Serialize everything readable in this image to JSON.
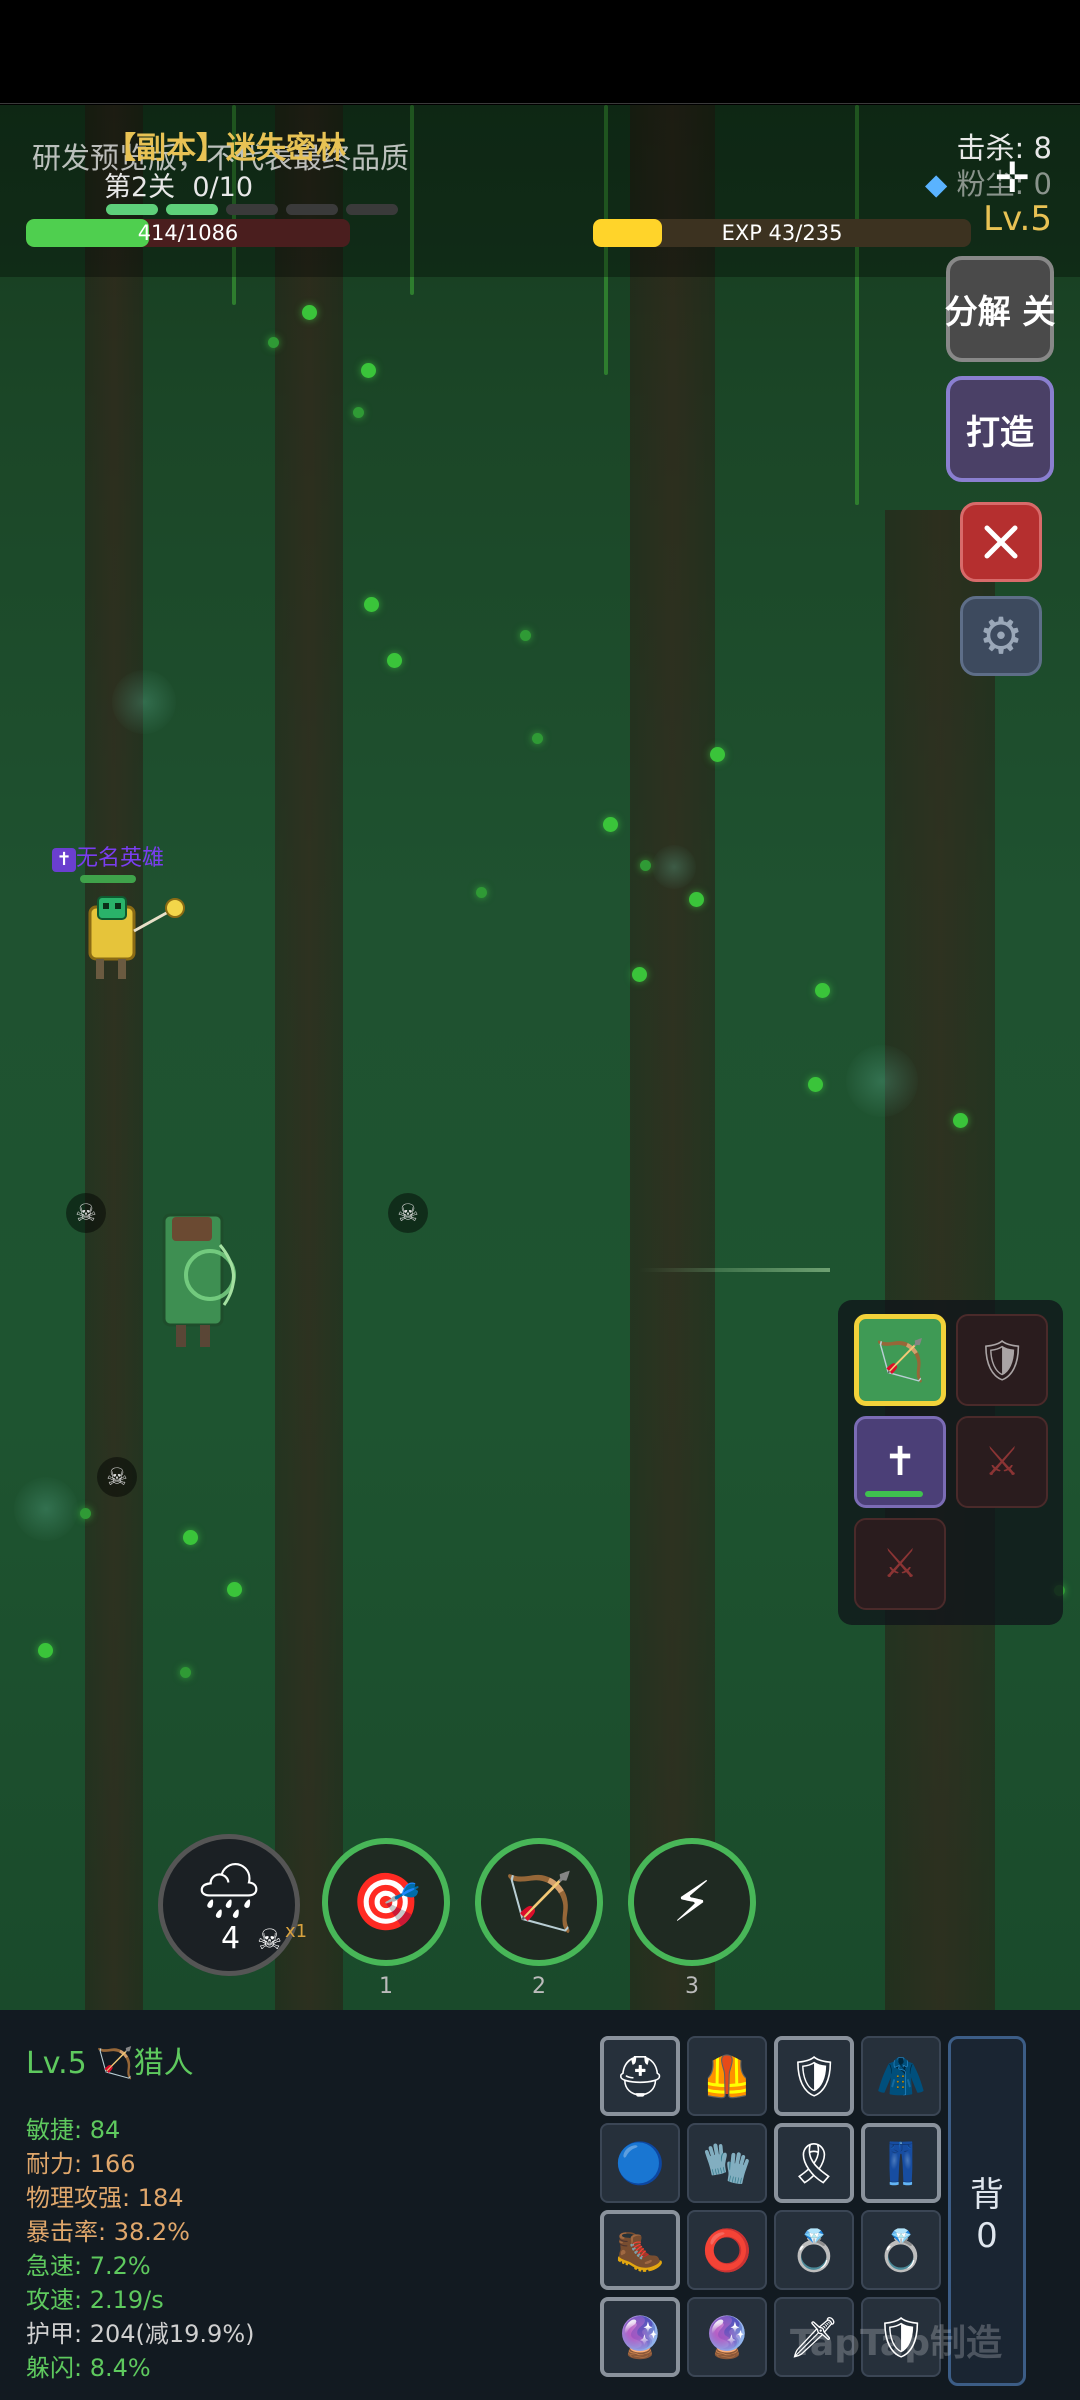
{
  "hud": {
    "dungeon_title": "【副本】迷失密林",
    "dev_notice": "研发预览版，不代表最终品质",
    "stage": "第2关",
    "stage_progress": "0/10",
    "stage_segments_done": 2,
    "stage_segments_total": 5,
    "hp_text": "414/1086",
    "hp_fraction": 0.38,
    "exp_text": "EXP 43/235",
    "exp_fraction": 0.183,
    "kills": "击杀: 8",
    "powder": "粉尘: 0",
    "level": "Lv.5"
  },
  "side_buttons": {
    "decompose": "分解 关",
    "forge": "打造",
    "close_icon": "close-icon",
    "settings_icon": "gear-icon"
  },
  "hero": {
    "name_tag": "无名英雄",
    "badge_icon": "cross-icon"
  },
  "slots": [
    {
      "icon": "bow-icon",
      "glyph": "🏹",
      "state": "active"
    },
    {
      "icon": "shield-locked-icon",
      "glyph": "🛡",
      "state": "locked"
    },
    {
      "icon": "cross-icon",
      "glyph": "✝",
      "state": "equipped",
      "progress": 0.7
    },
    {
      "icon": "sword-locked-icon",
      "glyph": "⚔",
      "state": "locked"
    },
    {
      "icon": "sword-locked-icon",
      "glyph": "⚔",
      "state": "locked"
    }
  ],
  "skills": {
    "weather": {
      "icon": "rain-cloud-icon",
      "count": "4",
      "skull_multiplier": "x1"
    },
    "items": [
      {
        "icon": "target-icon",
        "glyph": "🎯",
        "key": "1"
      },
      {
        "icon": "bow-icon",
        "glyph": "🏹",
        "key": "2"
      },
      {
        "icon": "lightning-icon",
        "glyph": "⚡",
        "key": "3"
      }
    ]
  },
  "character": {
    "level_class": "Lv.5",
    "class_name": "猎人",
    "class_icon": "bow-icon",
    "stats": [
      {
        "label": "敏捷: 84",
        "color": "#5ec95e"
      },
      {
        "label": "耐力: 166",
        "color": "#e0a76b"
      },
      {
        "label": "物理攻强: 184",
        "color": "#e0a76b"
      },
      {
        "label": "暴击率: 38.2%",
        "color": "#e0a76b"
      },
      {
        "label": "急速: 7.2%",
        "color": "#5ec95e"
      },
      {
        "label": "攻速: 2.19/s",
        "color": "#5ec95e"
      },
      {
        "label": "护甲: 204(减19.9%)",
        "color": "#cfcfcf"
      },
      {
        "label": "躲闪: 8.4%",
        "color": "#5ec95e"
      }
    ]
  },
  "equipment": [
    {
      "icon": "helmet-icon",
      "glyph": "⛑"
    },
    {
      "icon": "shoulders-icon",
      "glyph": "🦺"
    },
    {
      "icon": "chest-armor-icon",
      "glyph": "🛡"
    },
    {
      "icon": "cloak-icon",
      "glyph": "🧥"
    },
    {
      "icon": "amulet-icon",
      "glyph": "🔵"
    },
    {
      "icon": "bracers-icon",
      "glyph": "🧤"
    },
    {
      "icon": "belt-icon",
      "glyph": "🎗"
    },
    {
      "icon": "leg-armor-icon",
      "glyph": "👖"
    },
    {
      "icon": "boots-icon",
      "glyph": "🥾"
    },
    {
      "icon": "ring-icon",
      "glyph": "⭕"
    },
    {
      "icon": "ring-icon",
      "glyph": "💍"
    },
    {
      "icon": "ring-icon",
      "glyph": "💍"
    },
    {
      "icon": "orb-icon",
      "glyph": "🔮"
    },
    {
      "icon": "orb-icon",
      "glyph": "🔮"
    },
    {
      "icon": "sword-icon",
      "glyph": "🗡"
    },
    {
      "icon": "shield-icon",
      "glyph": "🛡"
    }
  ],
  "bag": {
    "label": "背",
    "count": "0"
  },
  "watermark": "TapTap制造",
  "colors": {
    "hp": "#4fcf4f",
    "exp": "#ffd42a",
    "gold_text": "#e8c254",
    "accent_green": "#48b758"
  }
}
